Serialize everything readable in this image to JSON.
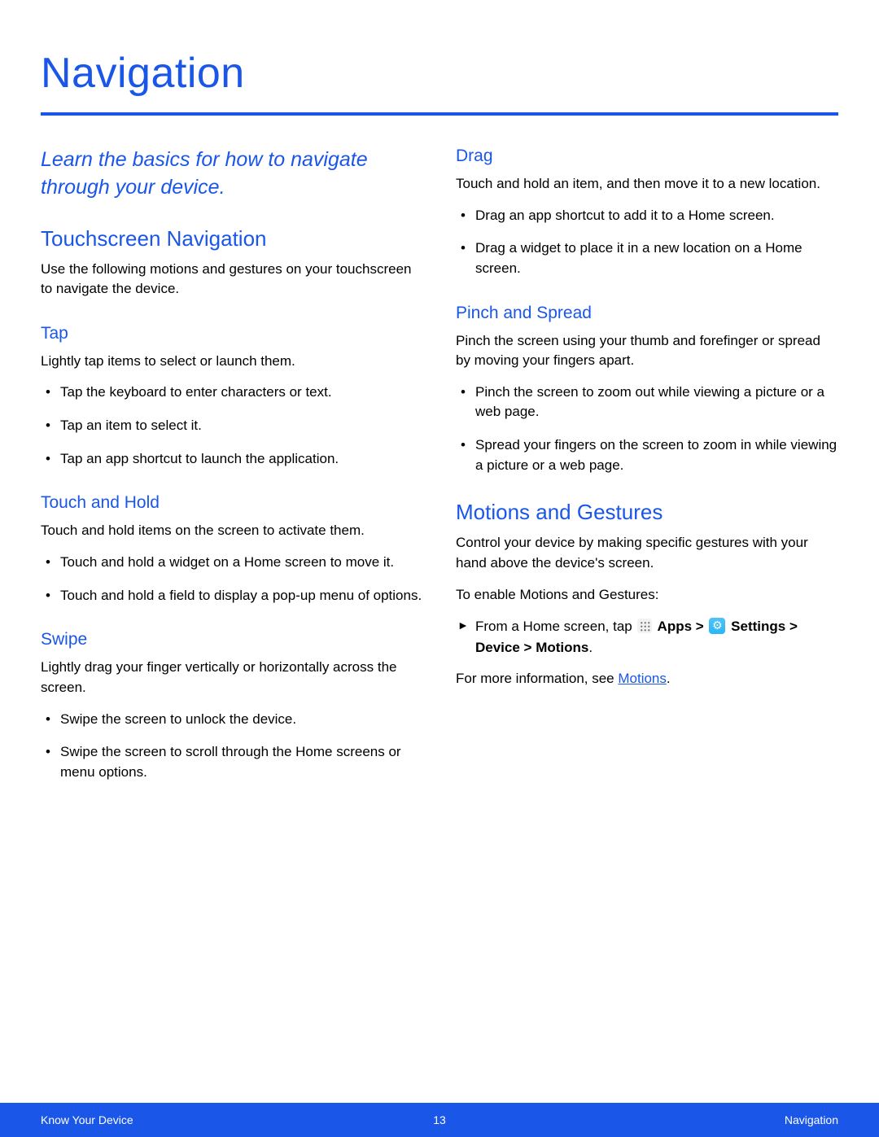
{
  "title": "Navigation",
  "intro": "Learn the basics for how to navigate through your device.",
  "left": {
    "h2": "Touchscreen Navigation",
    "h2_body": "Use the following motions and gestures on your touchscreen to navigate the device.",
    "tap": {
      "heading": "Tap",
      "body": "Lightly tap items to select or launch them.",
      "items": [
        "Tap the keyboard to enter characters or text.",
        "Tap an item to select it.",
        "Tap an app shortcut to launch the application."
      ]
    },
    "touch_hold": {
      "heading": "Touch and Hold",
      "body": "Touch and hold items on the screen to activate them.",
      "items": [
        "Touch and hold a widget on a Home screen to move it.",
        "Touch and hold a field to display a pop-up menu of options."
      ]
    },
    "swipe": {
      "heading": "Swipe",
      "body": "Lightly drag your finger vertically or horizontally across the screen.",
      "items": [
        "Swipe the screen to unlock the device.",
        "Swipe the screen to scroll through the Home screens or menu options."
      ]
    }
  },
  "right": {
    "drag": {
      "heading": "Drag",
      "body": "Touch and hold an item, and then move it to a new location.",
      "items": [
        "Drag an app shortcut to add it to a Home screen.",
        "Drag a widget to place it in a new location on a Home screen."
      ]
    },
    "pinch": {
      "heading": "Pinch and Spread",
      "body": "Pinch the screen using your thumb and forefinger or spread by moving your fingers apart.",
      "items": [
        "Pinch the screen to zoom out while viewing a picture or a web page.",
        "Spread your fingers on the screen to zoom in while viewing a picture or a web page."
      ]
    },
    "motions": {
      "heading": "Motions and Gestures",
      "body": "Control your device by making specific gestures with your hand above the device's screen.",
      "enable_label": "To enable Motions and Gestures:",
      "step_prefix": "From a Home screen, tap ",
      "apps_label": " Apps > ",
      "settings_label": " Settings > Device > Motions",
      "period": ".",
      "more_prefix": "For more information, see ",
      "link_text": "Motions",
      "more_suffix": "."
    }
  },
  "footer": {
    "left": "Know Your Device",
    "center": "13",
    "right": "Navigation"
  }
}
